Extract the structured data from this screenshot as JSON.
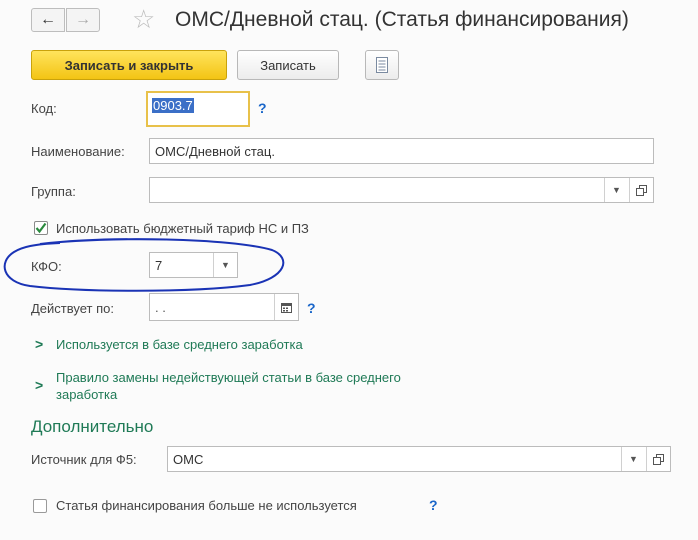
{
  "header": {
    "back_icon": "←",
    "forward_icon": "→",
    "star_icon": "☆",
    "title": "ОМС/Дневной стац. (Статья финансирования)"
  },
  "toolbar": {
    "save_close_label": "Записать и закрыть",
    "save_label": "Записать",
    "report_icon": "document-list-icon"
  },
  "form": {
    "code_label": "Код:",
    "code_value": "0903.7",
    "name_label": "Наименование:",
    "name_value": "ОМС/Дневной стац.",
    "group_label": "Группа:",
    "group_value": "",
    "budget_tariff_label": "Использовать бюджетный тариф НС и ПЗ",
    "budget_tariff_checked": true,
    "kfo_label": "КФО:",
    "kfo_value": "7",
    "valid_until_label": "Действует по:",
    "valid_until_value": " .  .",
    "help_mark": "?"
  },
  "links": {
    "avg_salary": "Используется в базе среднего заработка",
    "replace_rule_line1": "Правило замены недействующей статьи в базе среднего",
    "replace_rule_line2": "заработка"
  },
  "additional": {
    "heading": "Дополнительно",
    "source_label": "Источник для Ф5:",
    "source_value": "ОМС",
    "not_used_label": "Статья финансирования больше не используется",
    "not_used_checked": false
  },
  "colors": {
    "accent_green": "#1f7a56",
    "help_blue": "#1a66c9",
    "primary_yellow": "#f3c414",
    "annotation_blue": "#1a33b5"
  }
}
